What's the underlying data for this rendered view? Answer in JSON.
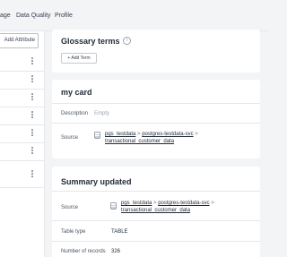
{
  "tabs": [
    {
      "label": "age"
    },
    {
      "label": "Data Quality"
    },
    {
      "label": "Profile"
    }
  ],
  "left_panel": {
    "add_attribute_label": "Add Attribute",
    "rows": 7
  },
  "glossary": {
    "title": "Glossary terms",
    "info_icon": "i",
    "add_term_label": "+ Add Term"
  },
  "my_card": {
    "title": "my card",
    "description_label": "Description",
    "description_value": "Empty",
    "source_label": "Source",
    "source_path": {
      "db": "pgs_testdata",
      "service": "postgres-testdata-svc",
      "table": "transactional_customer_data"
    }
  },
  "summary": {
    "title": "Summary updated",
    "source_label": "Source",
    "source_path": {
      "db": "pgs_testdata",
      "service": "postgres-testdata-svc",
      "table": "transactional_customer_data"
    },
    "table_type_label": "Table type",
    "table_type_value": "TABLE",
    "records_label": "Number of records",
    "records_value": "326"
  },
  "separator": ">",
  "colors": {
    "background": "#f3f4f6",
    "card": "#ffffff",
    "border": "#e5e7eb"
  }
}
